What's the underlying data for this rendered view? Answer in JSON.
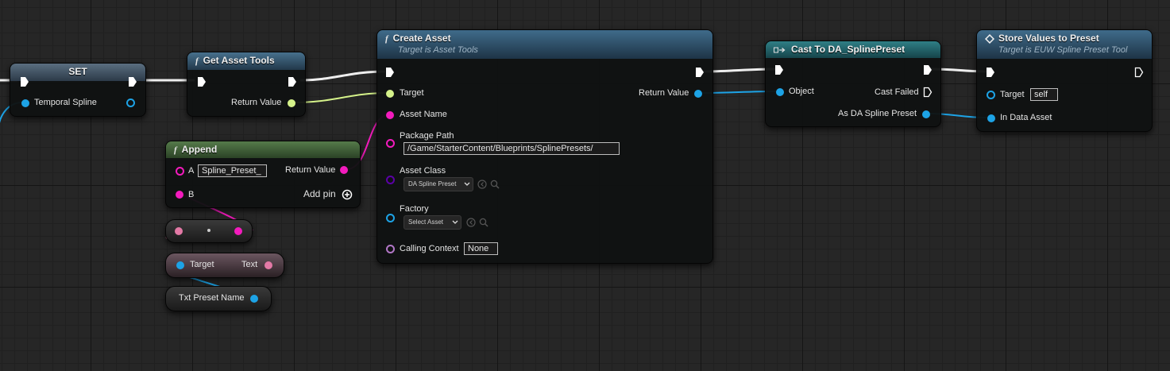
{
  "nodes": {
    "set": {
      "title": "SET",
      "pin_label": "Temporal Spline"
    },
    "get_asset_tools": {
      "title": "Get Asset Tools",
      "return_label": "Return Value"
    },
    "append": {
      "title": "Append",
      "pin_a": "A",
      "pin_a_value": "Spline_Preset_",
      "pin_b": "B",
      "return_label": "Return Value",
      "add_pin_label": "Add pin"
    },
    "to_text": {
      "target_label": "Target",
      "text_label": "Text"
    },
    "txt_preset": {
      "label": "Txt Preset Name"
    },
    "create_asset": {
      "title": "Create Asset",
      "subtitle": "Target is Asset Tools",
      "target_label": "Target",
      "asset_name_label": "Asset Name",
      "package_path_label": "Package Path",
      "package_path_value": "/Game/StarterContent/Blueprints/SplinePresets/",
      "asset_class_label": "Asset Class",
      "asset_class_value": "DA Spline Preset",
      "factory_label": "Factory",
      "factory_value": "Select Asset",
      "calling_context_label": "Calling Context",
      "calling_context_value": "None",
      "return_label": "Return Value"
    },
    "cast": {
      "title": "Cast To DA_SplinePreset",
      "object_label": "Object",
      "cast_failed_label": "Cast Failed",
      "as_label": "As DA Spline Preset"
    },
    "store": {
      "title": "Store Values to Preset",
      "subtitle": "Target is EUW Spline Preset Tool",
      "target_label": "Target",
      "target_value": "self",
      "in_data_label": "In Data Asset"
    }
  },
  "icons": {
    "function": "f",
    "cast": "cast-arrow-icon",
    "event": "diamond-icon"
  },
  "colors": {
    "exec": "#ffffff",
    "object_pin": "#1da3e6",
    "string_pin": "#f31bbd",
    "text_pin": "#e379a6",
    "class_pin": "#5b00a6",
    "struct_pin": "#0a8fcc",
    "wildcard_pin": "#b277c7",
    "asset_tools_pin": "#d5f28a",
    "header_function": "#3b5f78",
    "header_pure": "#4a7a3e",
    "header_cast": "#1c6f75"
  }
}
